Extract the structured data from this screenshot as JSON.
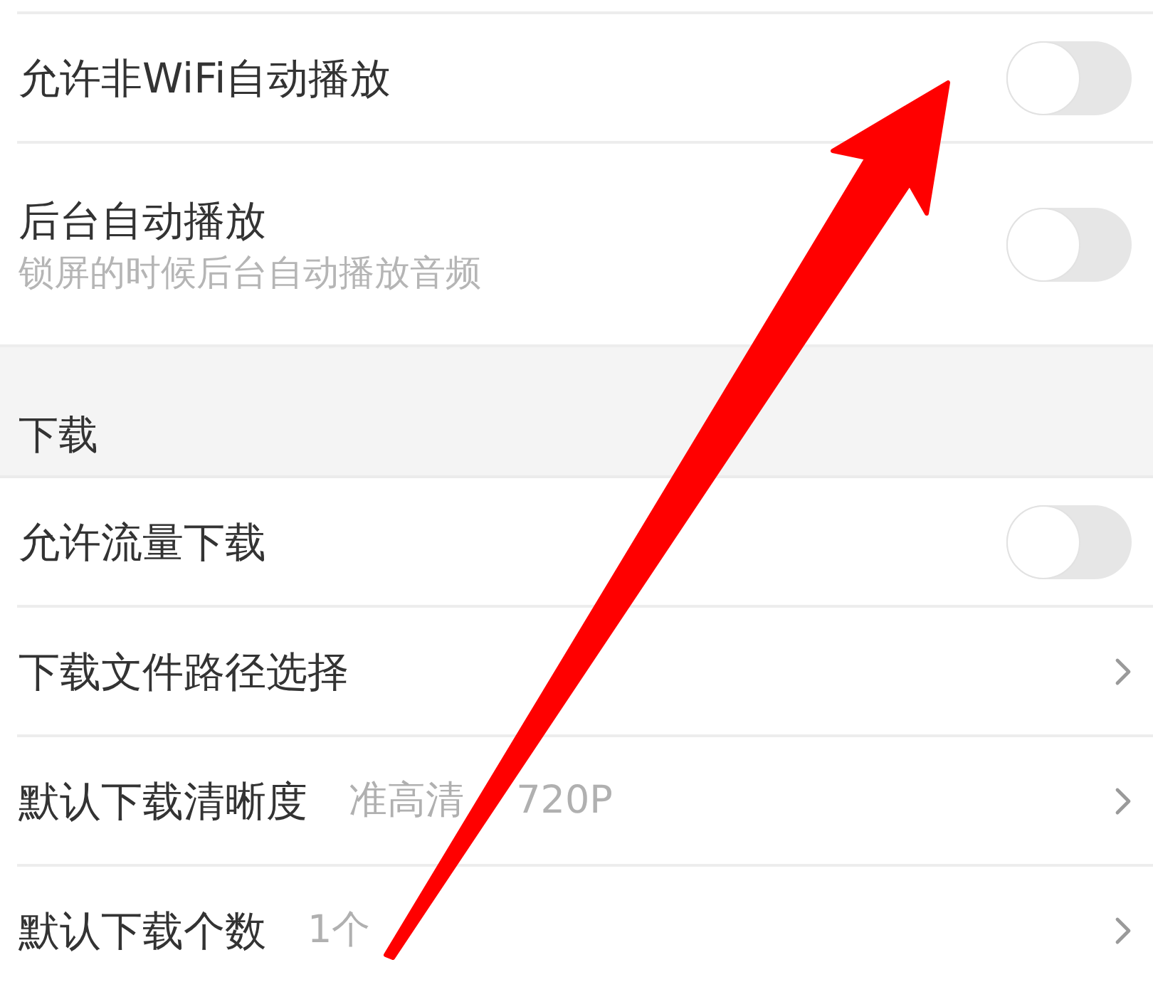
{
  "sections": [
    {
      "items": [
        {
          "kind": "toggle",
          "title": "允许非WiFi自动播放",
          "on": false
        },
        {
          "kind": "toggle",
          "title": "后台自动播放",
          "subtitle": "锁屏的时候后台自动播放音频",
          "on": false
        }
      ]
    },
    {
      "header": "下载",
      "items": [
        {
          "kind": "toggle",
          "title": "允许流量下载",
          "on": false
        },
        {
          "kind": "link",
          "title": "下载文件路径选择"
        },
        {
          "kind": "link",
          "title": "默认下载清晰度",
          "value": "准高清 720P"
        },
        {
          "kind": "link",
          "title": "默认下载个数",
          "value": "1个"
        }
      ]
    }
  ]
}
